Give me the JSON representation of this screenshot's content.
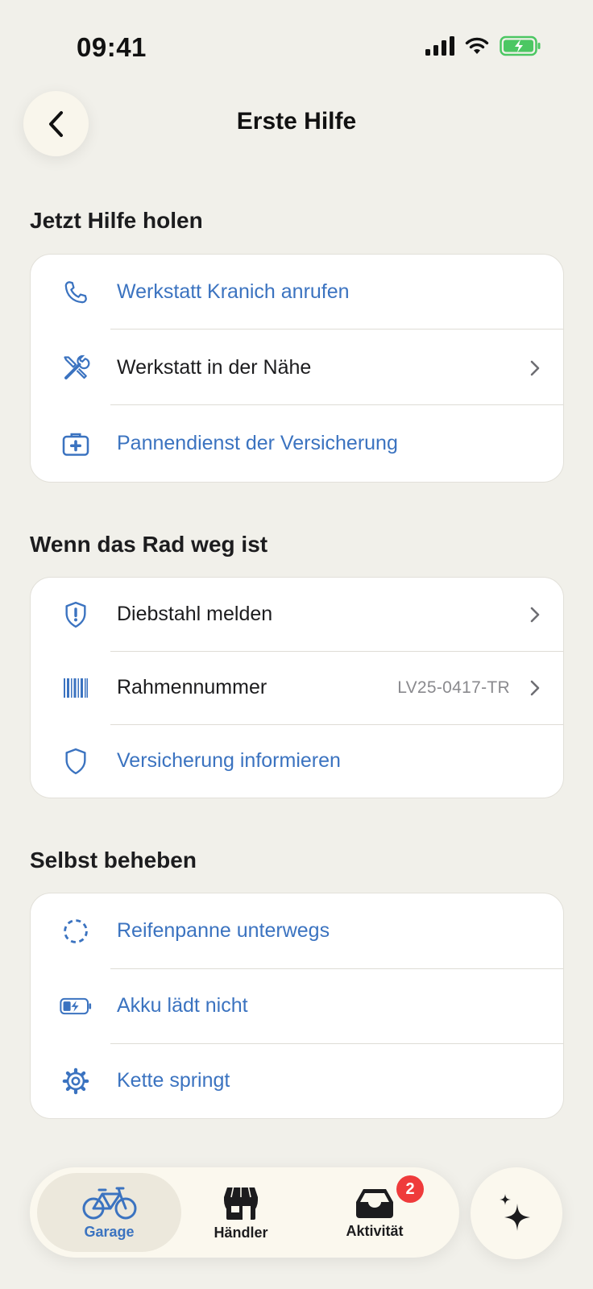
{
  "status": {
    "time": "09:41"
  },
  "header": {
    "title": "Erste Hilfe"
  },
  "sections": [
    {
      "title": "Jetzt Hilfe holen",
      "items": [
        {
          "label": "Werkstatt Kranich anrufen",
          "icon": "phone-icon"
        },
        {
          "label": "Werkstatt in der Nähe",
          "icon": "tools-icon"
        },
        {
          "label": "Pannendienst der Versicherung",
          "icon": "first-aid-kit-icon"
        }
      ]
    },
    {
      "title": "Wenn das Rad weg ist",
      "items": [
        {
          "label": "Diebstahl melden",
          "icon": "shield-alert-icon"
        },
        {
          "label": "Rahmennummer",
          "value": "LV25-0417-TR",
          "icon": "barcode-icon"
        },
        {
          "label": "Versicherung informieren",
          "icon": "shield-icon"
        }
      ]
    },
    {
      "title": "Selbst beheben",
      "items": [
        {
          "label": "Reifenpanne unterwegs",
          "icon": "dashed-circle-icon"
        },
        {
          "label": "Akku lädt nicht",
          "icon": "battery-charging-icon"
        },
        {
          "label": "Kette springt",
          "icon": "gear-icon"
        }
      ]
    }
  ],
  "tabbar": {
    "tabs": [
      {
        "label": "Garage",
        "icon": "bicycle-icon",
        "active": true
      },
      {
        "label": "Händler",
        "icon": "shop-icon"
      },
      {
        "label": "Aktivität",
        "icon": "inbox-icon",
        "badge": "2"
      }
    ],
    "fab_icon": "sparkles-icon"
  },
  "colors": {
    "accent": "#3b73c0",
    "background": "#f1f0ea",
    "badge": "#ef3b3b",
    "battery": "#4cc763"
  }
}
